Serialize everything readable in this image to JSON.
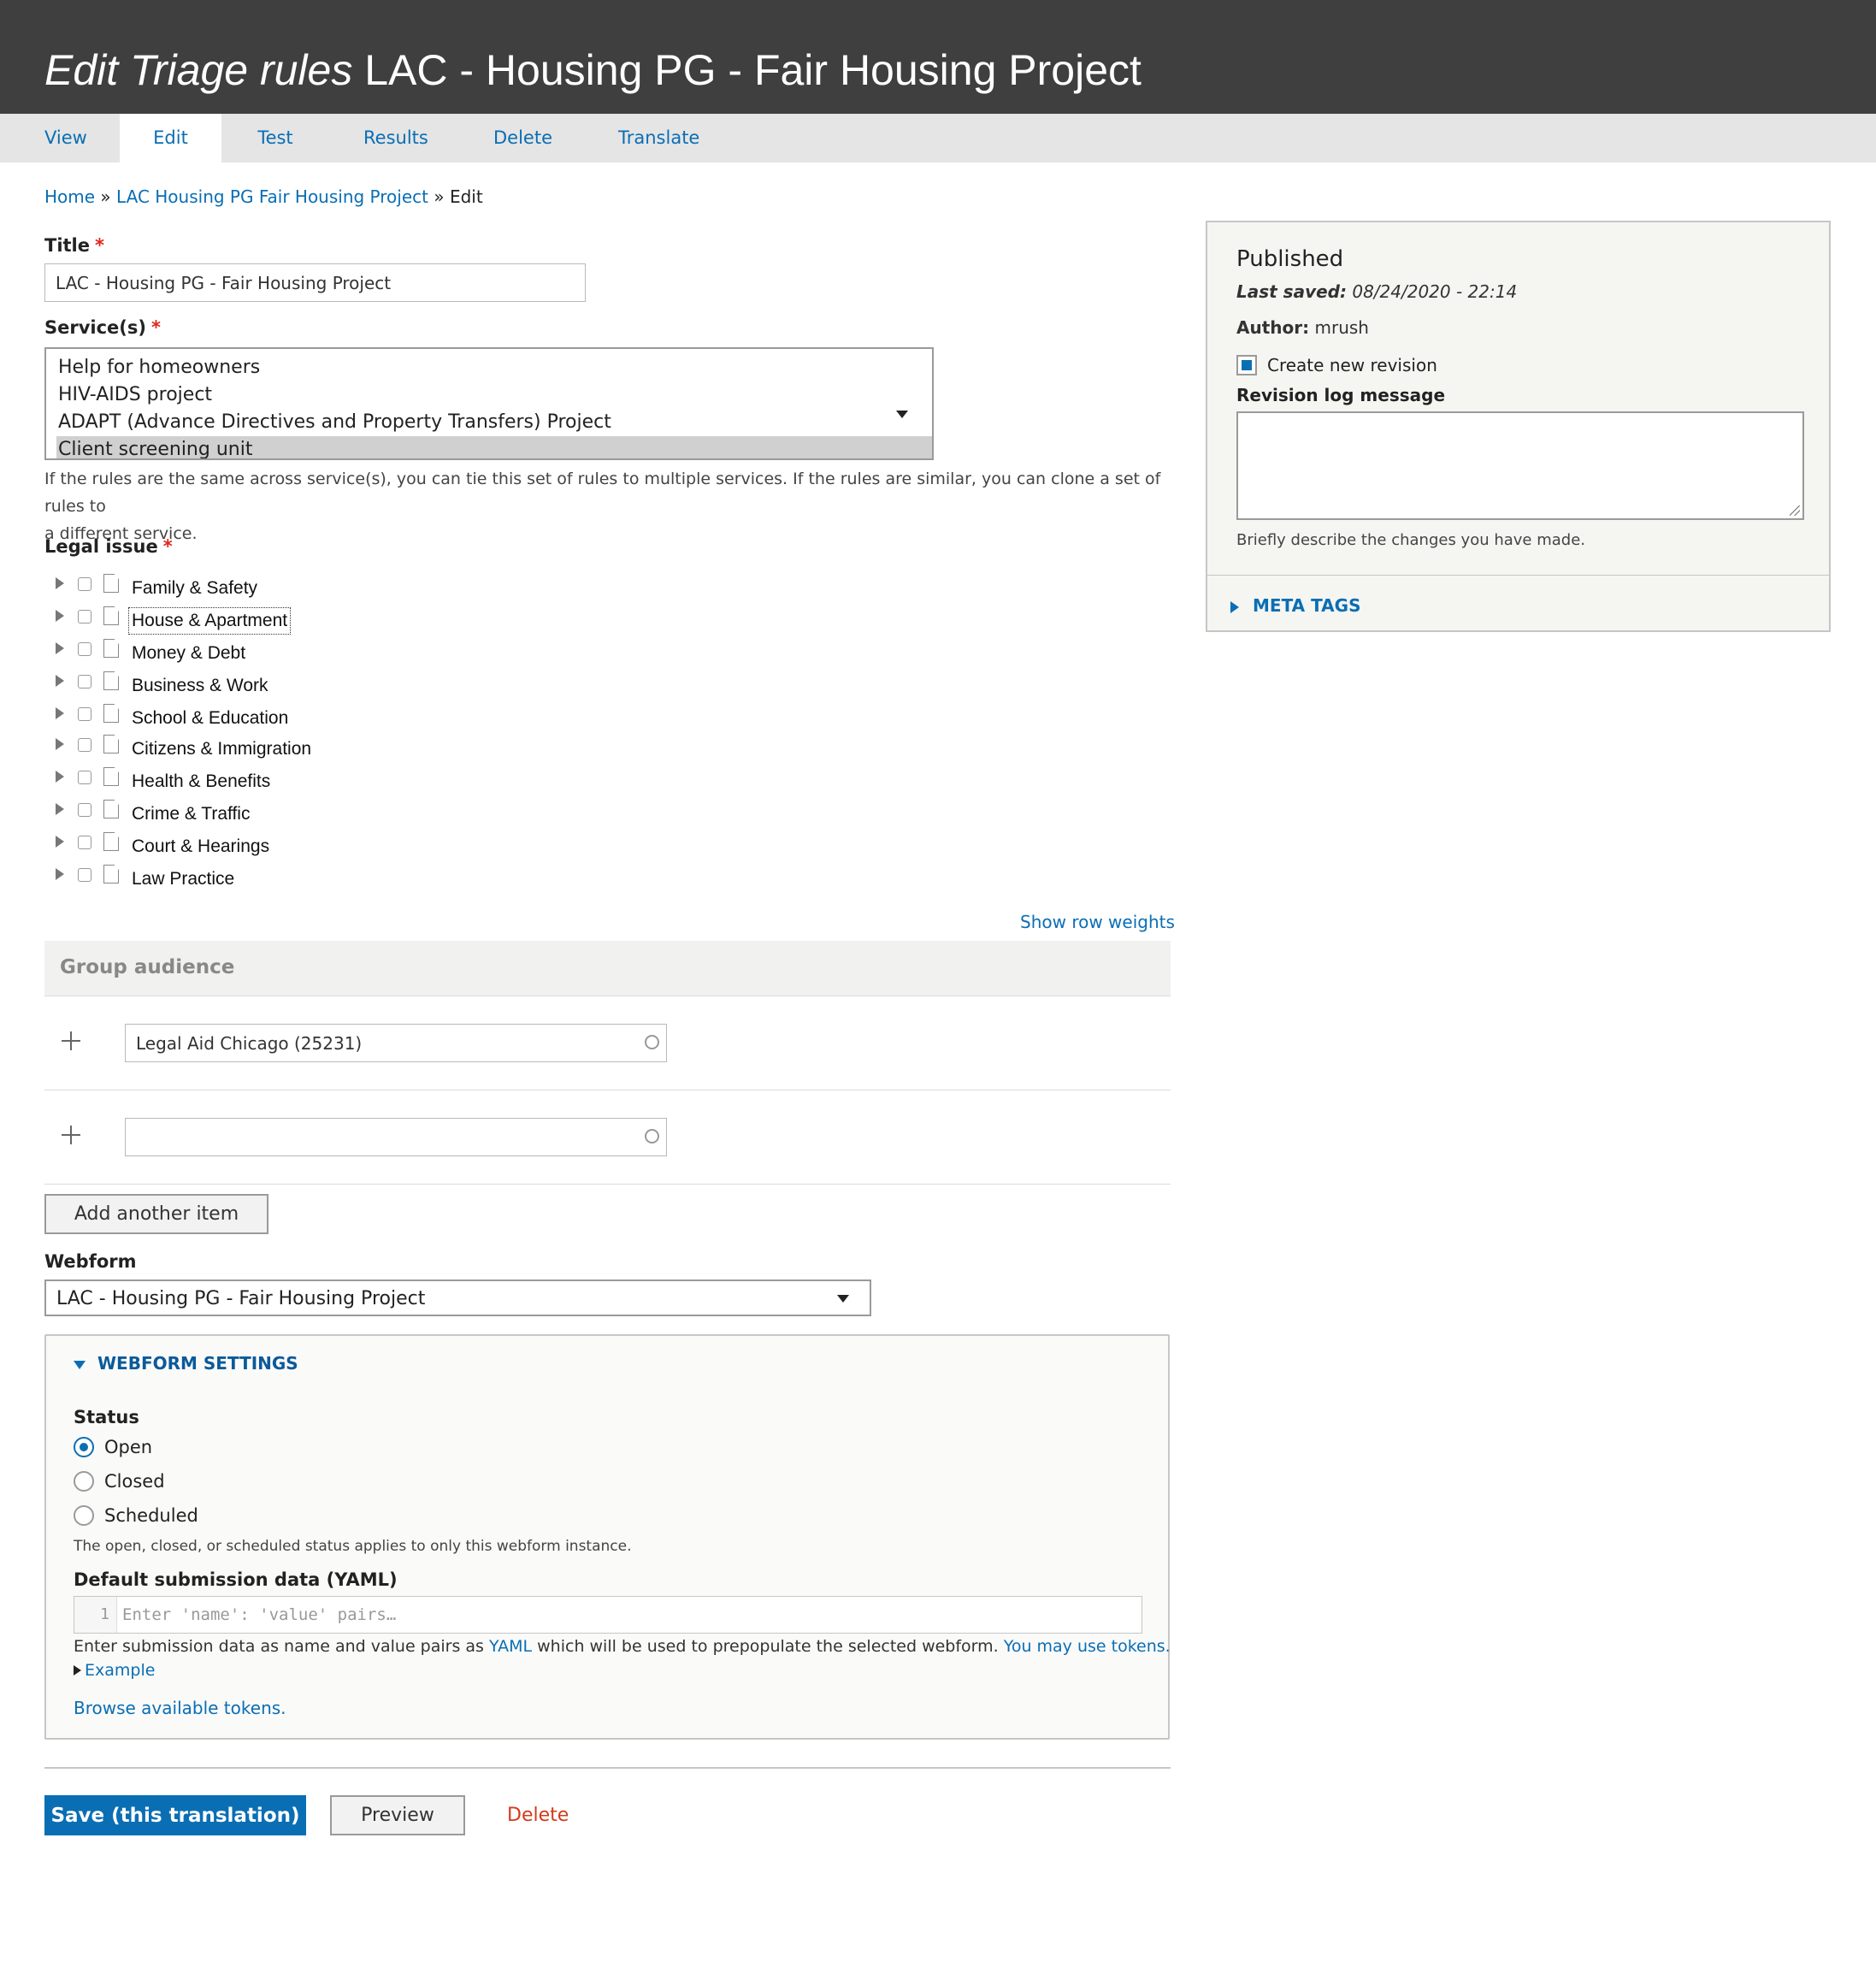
{
  "page": {
    "title_prefix": "Edit Triage rules",
    "title_node": "LAC - Housing PG - Fair Housing Project"
  },
  "tabs": [
    "View",
    "Edit",
    "Test",
    "Results",
    "Delete",
    "Translate"
  ],
  "active_tab": "Edit",
  "breadcrumb": {
    "home": "Home",
    "sep1": " » ",
    "node": "LAC Housing PG Fair Housing Project",
    "sep2": " » ",
    "current": "Edit"
  },
  "form": {
    "title_label": "Title",
    "required_mark": "*",
    "title_value": "LAC - Housing PG - Fair Housing Project",
    "services_label": "Service(s)",
    "services_options": [
      "Help for homeowners",
      "HIV-AIDS project",
      "ADAPT (Advance Directives and Property Transfers) Project",
      "Client screening unit"
    ],
    "services_selected": "Client screening unit",
    "services_description_line1": "If the rules are the same across service(s), you can tie this set of rules to multiple services. If the rules are similar, you can clone a set of rules to",
    "services_description_line2": "a different service.",
    "legal_issue_label": "Legal issue",
    "legal_issues": [
      "Family & Safety",
      "House & Apartment",
      "Money & Debt",
      "Business & Work",
      "School & Education",
      "Citizens & Immigration",
      "Health & Benefits",
      "Crime & Traffic",
      "Court & Hearings",
      "Law Practice"
    ],
    "show_row_weights": "Show row weights",
    "group_audience_label": "Group audience",
    "group_audience_items": [
      "Legal Aid Chicago (25231)",
      ""
    ],
    "add_another_item": "Add another item",
    "webform_label": "Webform",
    "webform_value": "LAC - Housing PG - Fair Housing Project",
    "webform_settings": {
      "summary": "WEBFORM SETTINGS",
      "status_label": "Status",
      "status_options": [
        "Open",
        "Closed",
        "Scheduled"
      ],
      "status_selected": "Open",
      "status_description": "The open, closed, or scheduled status applies to only this webform instance.",
      "yaml_label": "Default submission data (YAML)",
      "yaml_line_number": "1",
      "yaml_placeholder": "Enter 'name': 'value' pairs…",
      "yaml_desc_before": "Enter submission data as name and value pairs as ",
      "yaml_desc_link": "YAML",
      "yaml_desc_after": " which will be used to prepopulate the selected webform. ",
      "yaml_desc_tokens": "You may use tokens.",
      "example_link": "Example",
      "browse_tokens": "Browse available tokens."
    },
    "actions": {
      "save": "Save (this translation)",
      "preview": "Preview",
      "delete": "Delete"
    }
  },
  "sidebar": {
    "status": "Published",
    "last_saved_label": "Last saved:",
    "last_saved_value": "08/24/2020 - 22:14",
    "author_label": "Author:",
    "author_value": "mrush",
    "create_revision_label": "Create new revision",
    "create_revision_checked": true,
    "revision_log_label": "Revision log message",
    "revision_log_value": "",
    "revision_log_description": "Briefly describe the changes you have made.",
    "meta_tags": "META TAGS"
  },
  "colors": {
    "header_bg": "#3f3f3f",
    "link": "#0a6eb4",
    "primary_button": "#0a6eb4",
    "required": "#e0261b",
    "delete_link": "#d43a1a"
  }
}
